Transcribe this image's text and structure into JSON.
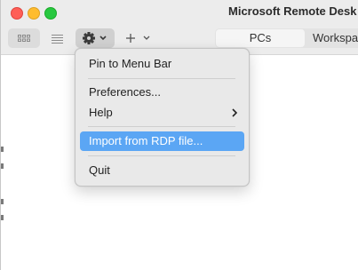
{
  "window": {
    "title": "Microsoft Remote Desk"
  },
  "tabs": {
    "pcs": "PCs",
    "workspaces": "Workspa"
  },
  "menu": {
    "items": [
      {
        "label": "Pin to Menu Bar"
      },
      {
        "label": "Preferences..."
      },
      {
        "label": "Help"
      },
      {
        "label": "Import from RDP file..."
      },
      {
        "label": "Quit"
      }
    ]
  },
  "colors": {
    "highlight": "#5ba6f4",
    "close": "#fe5f57",
    "minimize": "#febc2e",
    "zoom": "#28c840"
  },
  "icons": [
    "grid-view-icon",
    "list-view-icon",
    "gear-icon",
    "chevron-down-icon",
    "plus-icon",
    "chevron-right-icon"
  ]
}
